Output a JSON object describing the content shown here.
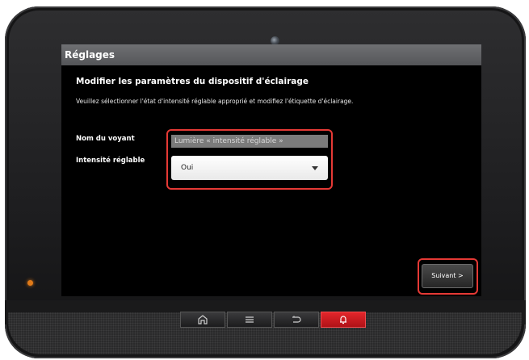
{
  "window": {
    "title": "Réglages"
  },
  "page": {
    "heading": "Modifier les paramètres du dispositif d'éclairage",
    "description": "Veuillez sélectionner l'état d'intensité réglable approprié et modifiez l'étiquette d'éclairage."
  },
  "form": {
    "name_label": "Nom du voyant",
    "name_value": "Lumière « intensité réglable »",
    "dimmable_label": "Intensité réglable",
    "dimmable_value": "Oui"
  },
  "buttons": {
    "next": "Suivant >"
  },
  "hardware_buttons": [
    "home-icon",
    "menu-icon",
    "back-icon",
    "alert-icon"
  ],
  "colors": {
    "highlight": "#e53935",
    "alert_button": "#d81b20",
    "status_led": "#e07a18"
  }
}
